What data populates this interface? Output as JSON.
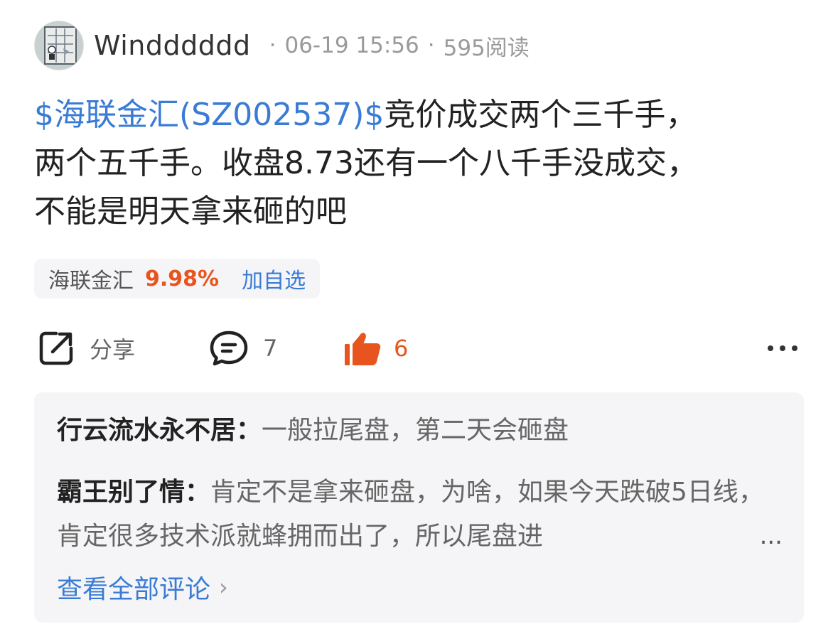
{
  "post": {
    "author": "Windddddd",
    "date": "06-19 15:56",
    "views": "595阅读",
    "content": {
      "stock_tag": "$海联金汇(SZ002537)$",
      "line1": "竞价成交两个三千手，",
      "line2": "两个五千手。收盘8.73还有一个八千手没成交，",
      "line3": "不能是明天拿来砸的吧"
    }
  },
  "stock_chip": {
    "name": "海联金汇",
    "change": "9.98%",
    "add_label": "加自选",
    "change_color": "#e8541e"
  },
  "actions": {
    "share_label": "分享",
    "comment_count": "7",
    "like_count": "6",
    "like_color": "#e8541e"
  },
  "comments": [
    {
      "user": "行云流水永不居",
      "text": "一般拉尾盘，第二天会砸盘"
    },
    {
      "user": "霸王别了情",
      "text": "肯定不是拿来砸盘，为啥，如果今天跌破5日线，肯定很多技术派就蜂拥而出了，所以尾盘进"
    }
  ],
  "comments_more": "...",
  "view_all_label": "查看全部评论",
  "colors": {
    "link": "#3a7bd5",
    "accent": "#e8541e",
    "panel": "#f5f5f7"
  }
}
